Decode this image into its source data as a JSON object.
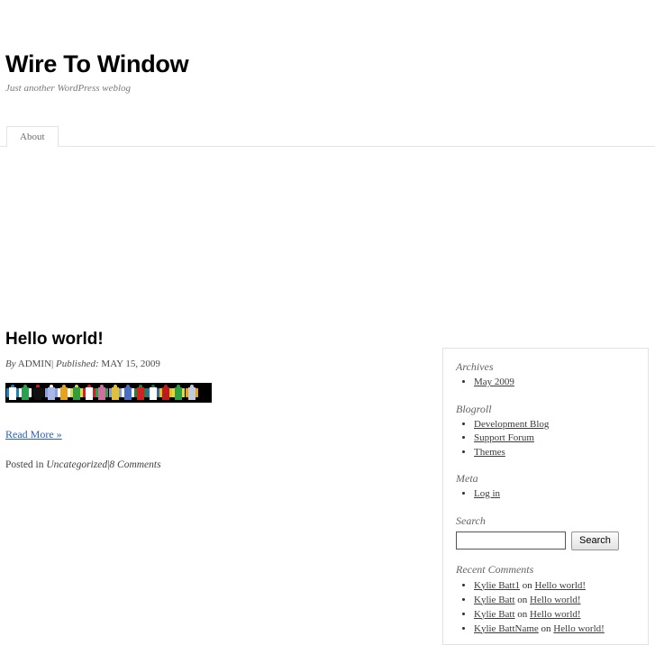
{
  "site": {
    "title": "Wire To Window",
    "description": "Just another WordPress weblog"
  },
  "nav": {
    "items": [
      {
        "label": "About"
      }
    ]
  },
  "post": {
    "title": "Hello world!",
    "by_label": "By",
    "author": "ADMIN",
    "meta_separator": "|",
    "published_label": "Published:",
    "date": "MAY 15, 2009",
    "image_alt": "racing-silks-strip",
    "read_more": "Read More »",
    "posted_in_label": "Posted in",
    "category": "Uncategorized",
    "footer_separator": "|",
    "comments": "8 Comments"
  },
  "silks": [
    {
      "torso": "#ffffff",
      "sleeve": "#1f7fb8",
      "cap": "#1f7fb8"
    },
    {
      "torso": "#2e9e4f",
      "sleeve": "#ffffff",
      "cap": "#2e9e4f"
    },
    {
      "torso": "#101010",
      "sleeve": "#101010",
      "cap": "#d02020"
    },
    {
      "torso": "#a9b6e8",
      "sleeve": "#8f9fdd",
      "cap": "#ffffff"
    },
    {
      "torso": "#e8a21c",
      "sleeve": "#ffffff",
      "cap": "#e8a21c"
    },
    {
      "torso": "#2f9e3f",
      "sleeve": "#e0d84a",
      "cap": "#e0d84a"
    },
    {
      "torso": "#ffffff",
      "sleeve": "#cf2222",
      "cap": "#cf2222"
    },
    {
      "torso": "#cf6f9f",
      "sleeve": "#2e9e4f",
      "cap": "#cf6f9f"
    },
    {
      "torso": "#e0c03a",
      "sleeve": "#8aa0c8",
      "cap": "#e0c03a"
    },
    {
      "torso": "#4a6fc0",
      "sleeve": "#ffffff",
      "cap": "#4a6fc0"
    },
    {
      "torso": "#cf2222",
      "sleeve": "#2e7d3a",
      "cap": "#2e7d3a"
    },
    {
      "torso": "#ffffff",
      "sleeve": "#2f6fb0",
      "cap": "#1d6f3d"
    },
    {
      "torso": "#b81c1c",
      "sleeve": "#e8c01c",
      "cap": "#b81c1c"
    },
    {
      "torso": "#2f9e3f",
      "sleeve": "#e0d84a",
      "cap": "#2f9e3f"
    },
    {
      "torso": "#c0ccdd",
      "sleeve": "#e8a21c",
      "cap": "#c0ccdd"
    }
  ],
  "sidebar": {
    "archives": {
      "title": "Archives",
      "items": [
        {
          "label": "May 2009"
        }
      ]
    },
    "blogroll": {
      "title": "Blogroll",
      "items": [
        {
          "label": "Development Blog"
        },
        {
          "label": "Support Forum"
        },
        {
          "label": "Themes"
        }
      ]
    },
    "meta": {
      "title": "Meta",
      "items": [
        {
          "label": "Log in"
        }
      ]
    },
    "search": {
      "title": "Search",
      "value": "",
      "placeholder": "",
      "button_label": "Search"
    },
    "recent_comments": {
      "title": "Recent Comments",
      "on_label": "on",
      "items": [
        {
          "author": "Kylie Batt1",
          "post": "Hello world!"
        },
        {
          "author": "Kylie Batt",
          "post": "Hello world!"
        },
        {
          "author": "Kylie Batt",
          "post": "Hello world!"
        },
        {
          "author": "Kylie BattName",
          "post": "Hello world!"
        }
      ]
    }
  }
}
